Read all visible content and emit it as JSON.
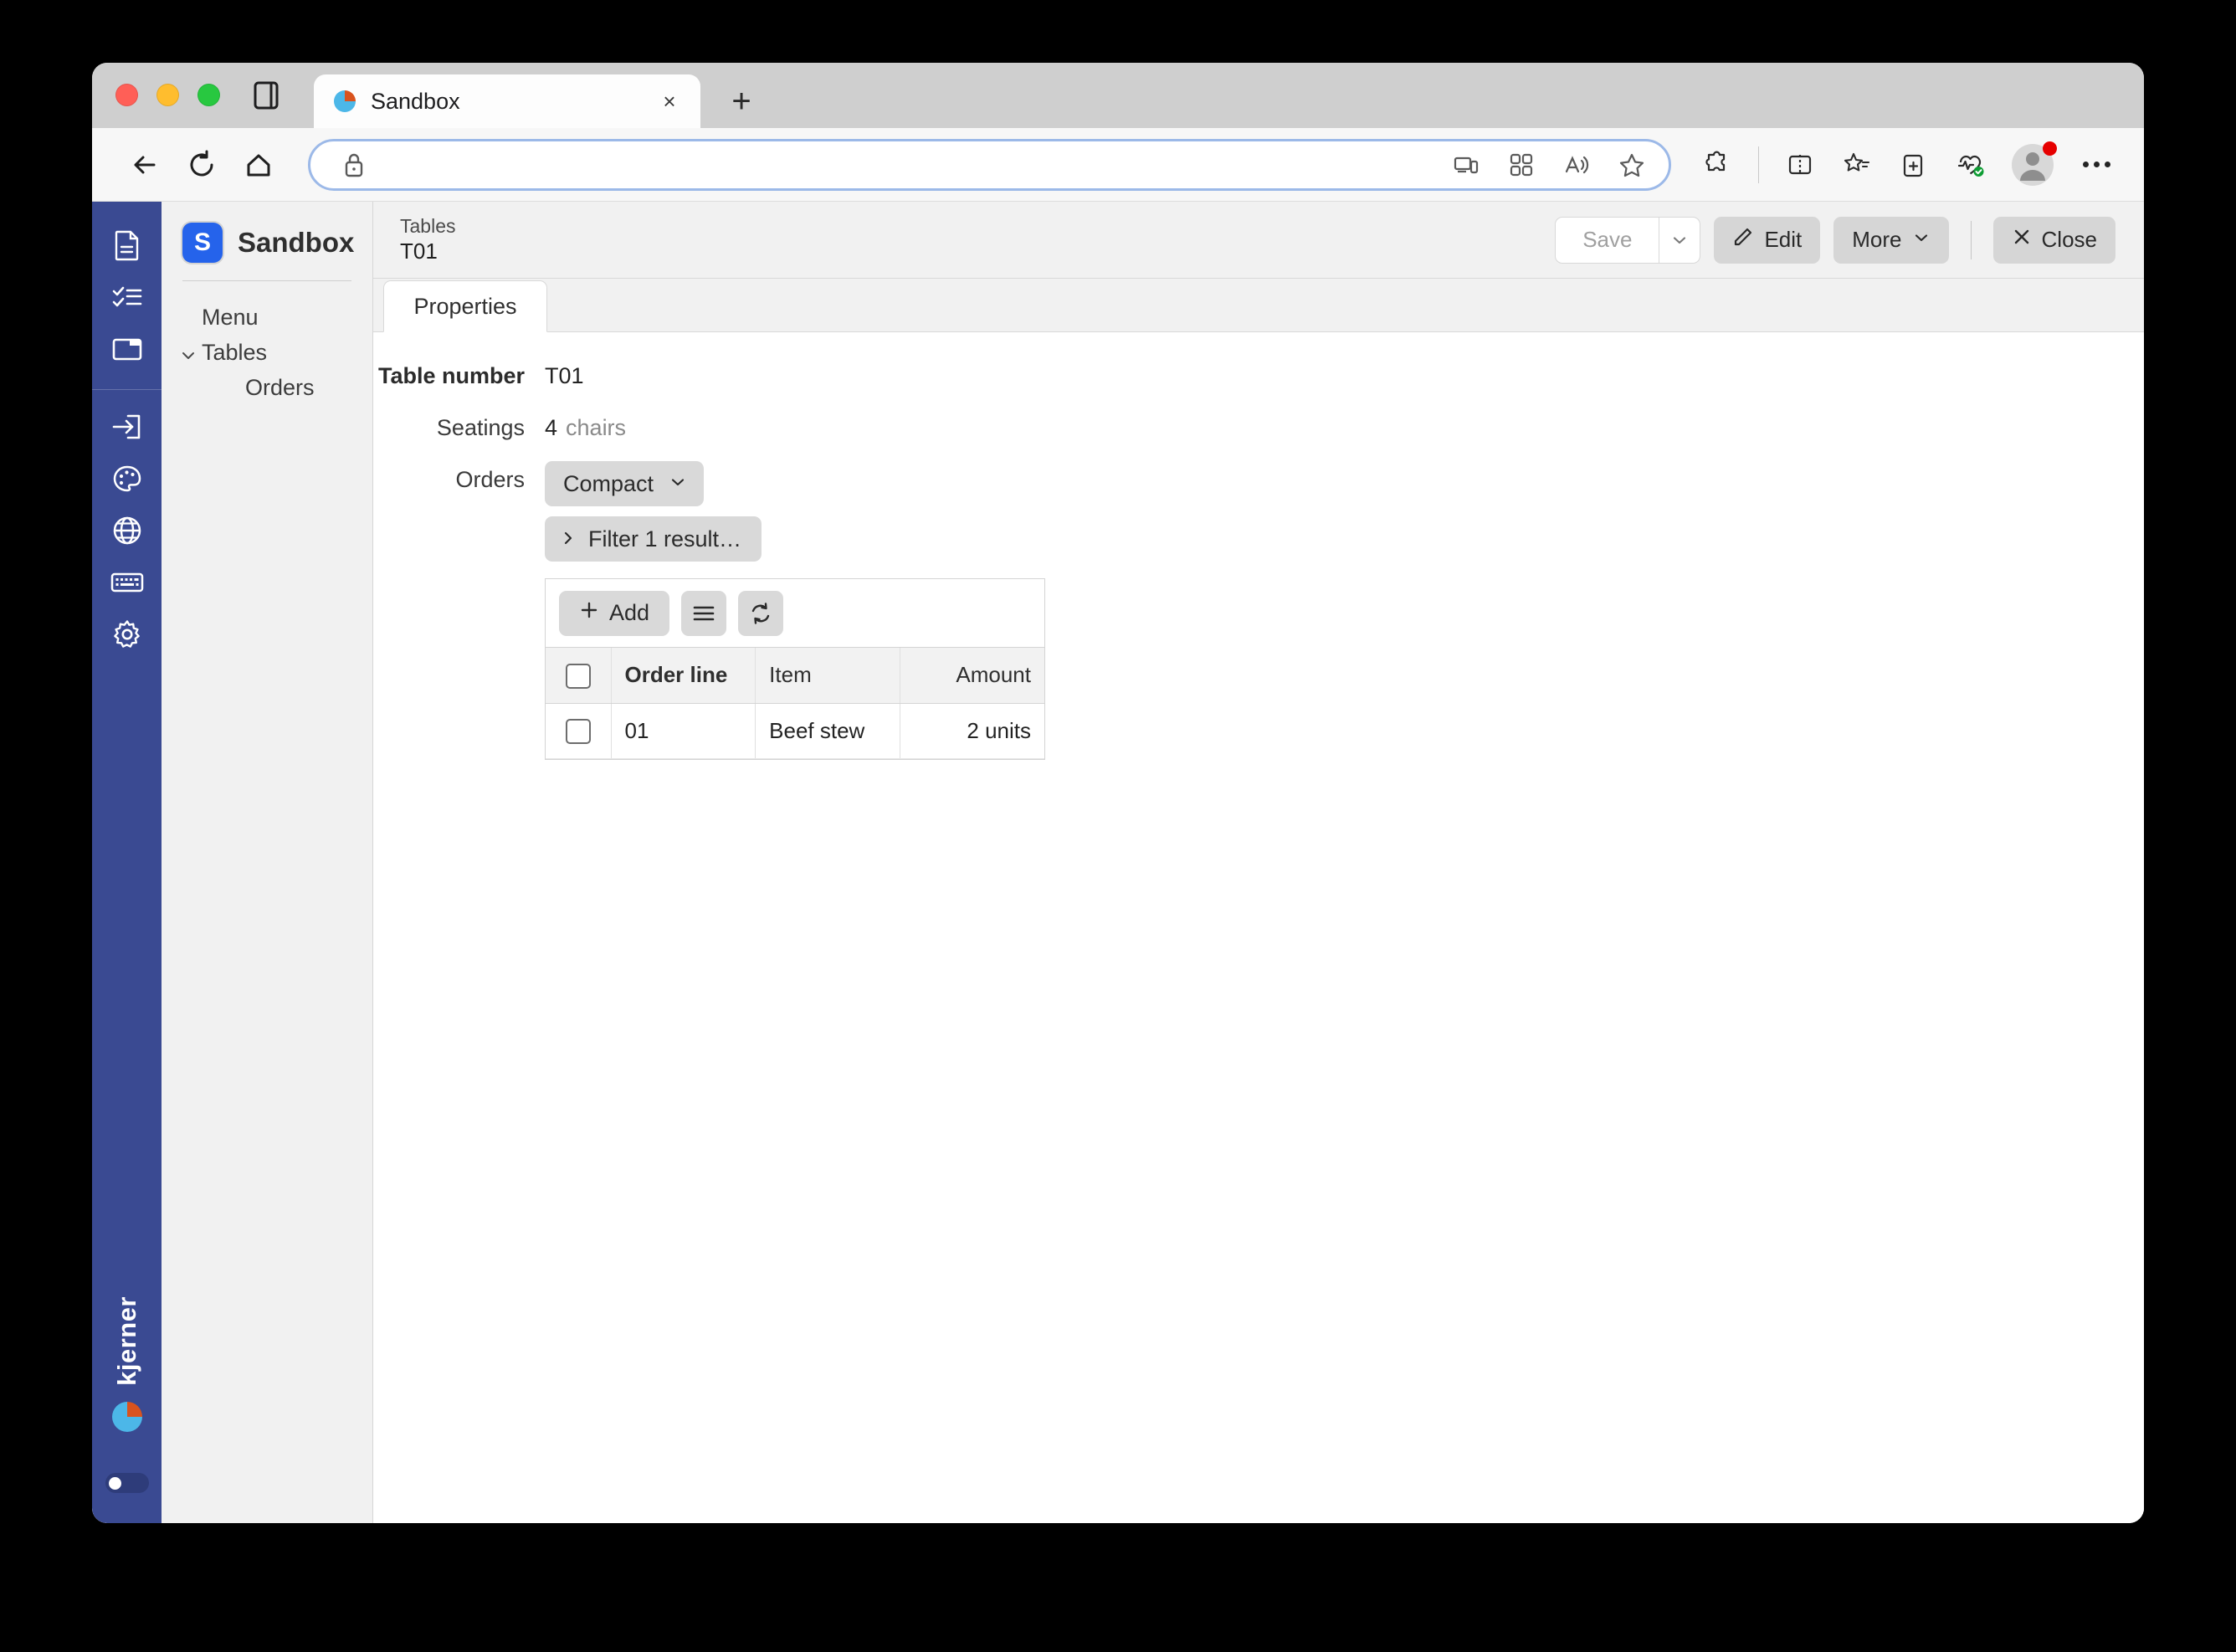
{
  "browser": {
    "tab": {
      "title": "Sandbox",
      "close_label": "×",
      "favicon_name": "kjerner-pie-favicon"
    },
    "new_tab_label": "+",
    "address": {
      "value": "",
      "placeholder": ""
    },
    "nav": {
      "back_label": "Back",
      "reload_label": "Reload",
      "home_label": "Home"
    },
    "toolbar_icons": [
      "device-cast-icon",
      "qr-code-icon",
      "read-aloud-icon",
      "favorite-star-icon",
      "extensions-puzzle-icon",
      "split-screen-icon",
      "favorites-list-icon",
      "collections-add-icon",
      "performance-heart-icon"
    ],
    "profile_label": "Profile",
    "settings_label": "Settings and more"
  },
  "app": {
    "brand": {
      "logo_letter": "S",
      "name": "Sandbox"
    },
    "rail": {
      "items": [
        {
          "name": "document-icon",
          "label": "Documents"
        },
        {
          "name": "checklist-icon",
          "label": "Tasks"
        },
        {
          "name": "window-icon",
          "label": "Windows"
        },
        {
          "name": "login-arrow-icon",
          "label": "Sign in"
        },
        {
          "name": "palette-icon",
          "label": "Theme"
        },
        {
          "name": "globe-icon",
          "label": "Language"
        },
        {
          "name": "keyboard-icon",
          "label": "Shortcuts"
        },
        {
          "name": "gear-icon",
          "label": "Settings"
        }
      ],
      "brand_text": "kjerner",
      "toggle_state": "off"
    },
    "nav": {
      "items": [
        {
          "label": "Menu",
          "indent": false,
          "expandable": false
        },
        {
          "label": "Tables",
          "indent": false,
          "expandable": true,
          "expanded": true
        },
        {
          "label": "Orders",
          "indent": true,
          "expandable": false
        }
      ]
    },
    "header": {
      "breadcrumb_parent": "Tables",
      "breadcrumb_current": "T01",
      "save_label": "Save",
      "edit_label": "Edit",
      "more_label": "More",
      "close_label": "Close"
    },
    "tabs": [
      {
        "label": "Properties",
        "active": true
      }
    ],
    "form": {
      "table_number": {
        "label": "Table number",
        "value": "T01"
      },
      "seatings": {
        "label": "Seatings",
        "value": "4",
        "unit": "chairs"
      },
      "orders": {
        "label": "Orders",
        "view_mode": "Compact",
        "filter_label": "Filter 1 result…"
      }
    },
    "grid": {
      "add_label": "Add",
      "menu_icon": "hamburger-menu-icon",
      "refresh_icon": "refresh-icon",
      "columns": [
        {
          "key": "select",
          "label": "",
          "bold": false
        },
        {
          "key": "order_line",
          "label": "Order line",
          "bold": true
        },
        {
          "key": "item",
          "label": "Item",
          "bold": false
        },
        {
          "key": "amount",
          "label": "Amount",
          "bold": false
        }
      ],
      "rows": [
        {
          "order_line": "01",
          "item": "Beef stew",
          "amount": "2 units"
        }
      ]
    }
  },
  "colors": {
    "rail_blue": "#3a4a92",
    "logo_blue": "#2563eb",
    "panel_gray": "#f1f1f1",
    "button_gray": "#d9d9d9",
    "accent_cyan": "#4cb7e8",
    "accent_orange": "#d9531e"
  }
}
